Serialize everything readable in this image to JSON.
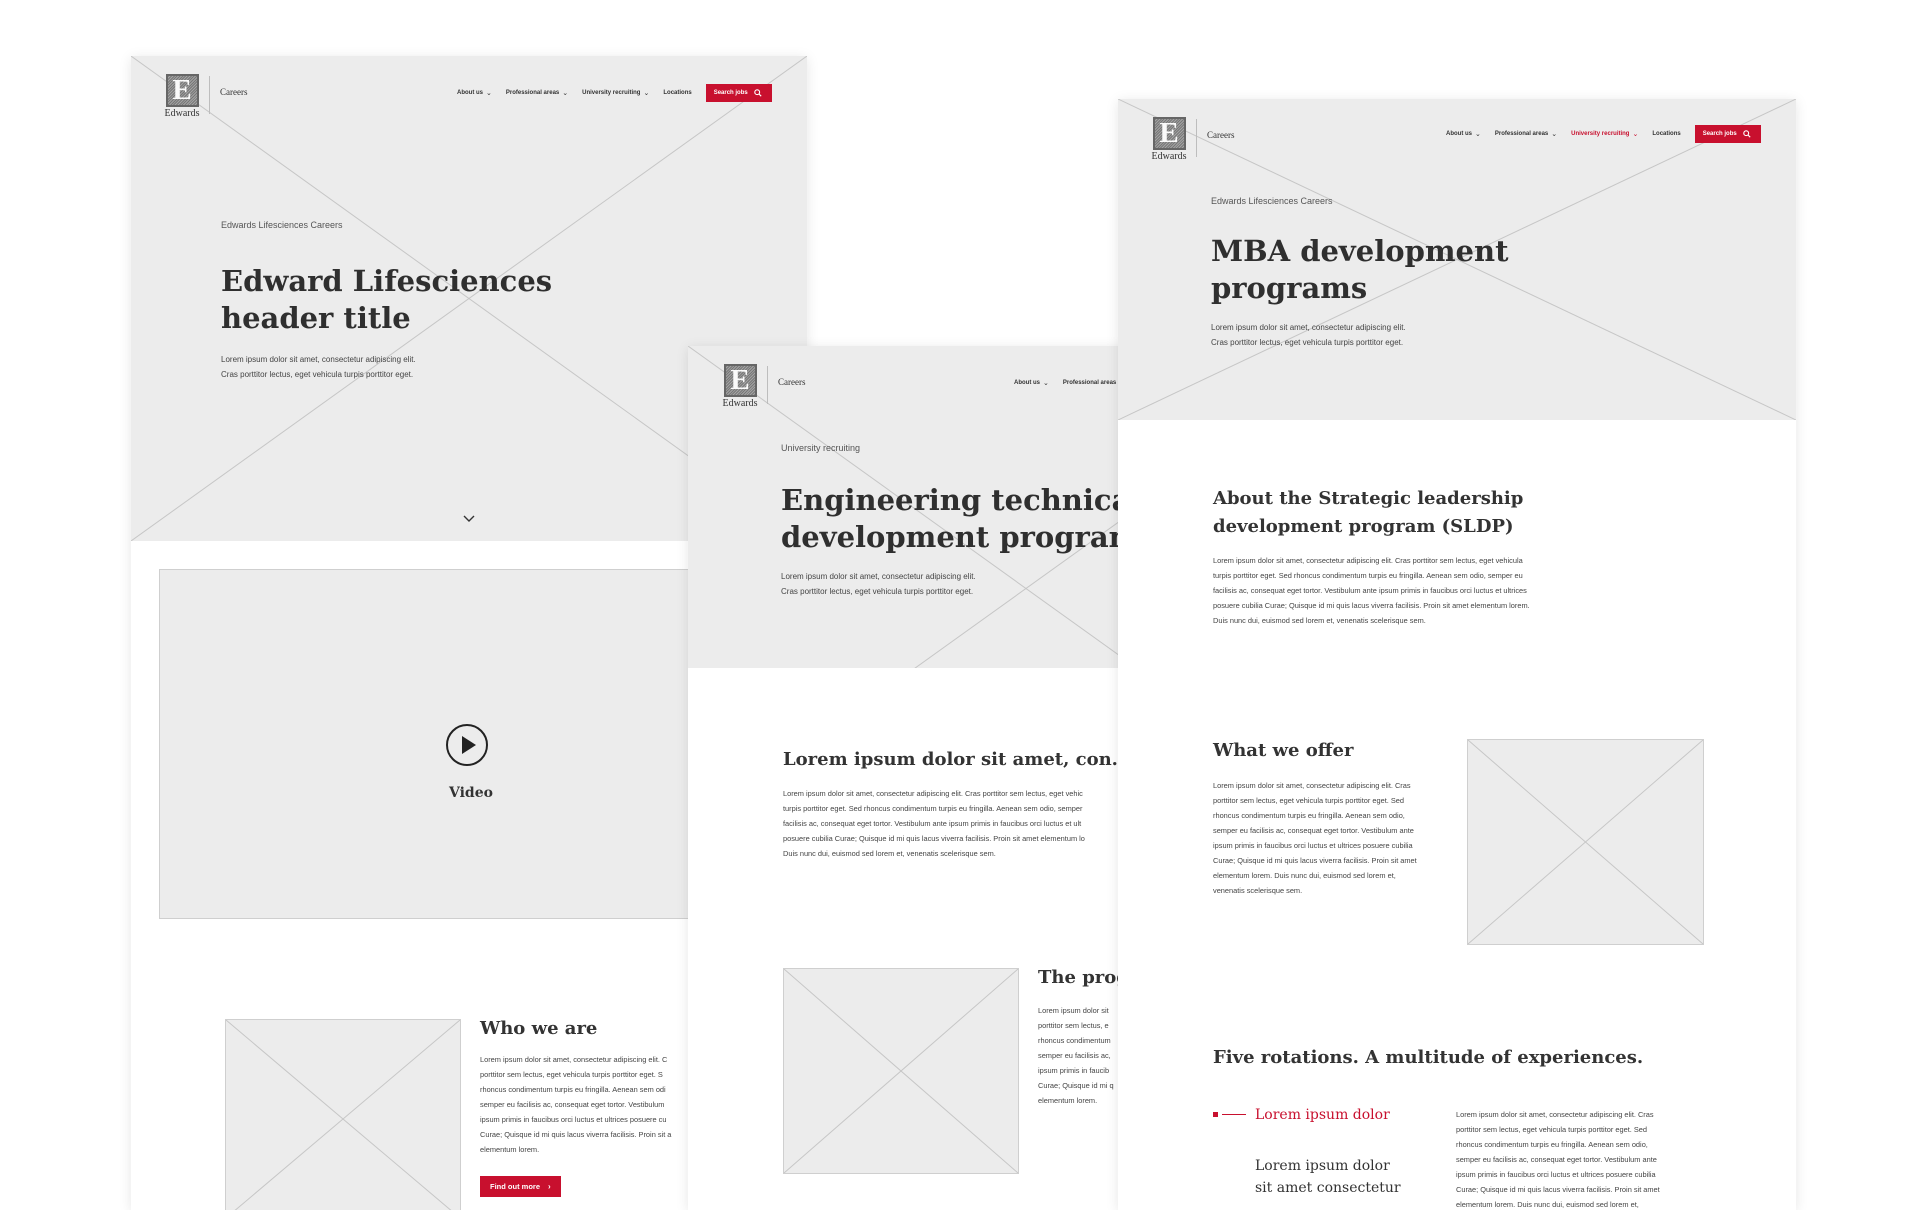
{
  "colors": {
    "brand_red": "#c8102e",
    "placeholder_gray": "#ececec",
    "text_dark": "#333333"
  },
  "logo": {
    "letter": "E",
    "word": "Edwards",
    "careers": "Careers"
  },
  "nav": {
    "about": "About us",
    "professional": "Professional areas",
    "university": "University recruiting",
    "locations": "Locations",
    "search": "Search jobs",
    "search_icon": "search-icon",
    "chevron_icon": "chevron-down-icon"
  },
  "page_a": {
    "eyebrow": "Edwards Lifesciences Careers",
    "title_lines": [
      "Edward Lifesciences",
      "header title"
    ],
    "lead_lines": [
      "Lorem ipsum dolor sit amet, consectetur adipiscing elit.",
      "Cras porttitor lectus, eget vehicula turpis porttitor eget."
    ],
    "video_label": "Video",
    "who_title": "Who we are",
    "who_lines": [
      "Lorem ipsum dolor sit amet, consectetur adipiscing elit. C",
      "porttitor sem lectus, eget vehicula turpis porttitor eget. S",
      "rhoncus condimentum turpis eu fringilla. Aenean sem odi",
      "semper eu facilisis ac, consequat eget tortor. Vestibulum",
      "ipsum primis in faucibus orci luctus et ultrices posuere cu",
      "Curae; Quisque id mi quis lacus viverra facilisis. Proin sit a",
      "elementum lorem."
    ],
    "cta": "Find out more"
  },
  "page_b": {
    "eyebrow": "University recruiting",
    "title_lines": [
      "Engineering technical",
      "development program"
    ],
    "lead_lines": [
      "Lorem ipsum dolor sit amet, consectetur adipiscing elit.",
      "Cras porttitor lectus, eget vehicula turpis porttitor eget."
    ],
    "section_title": "Lorem ipsum dolor sit amet, con.",
    "section_lines": [
      "Lorem ipsum dolor sit amet, consectetur adipiscing elit. Cras porttitor sem lectus, eget vehic",
      "turpis porttitor eget. Sed rhoncus condimentum turpis eu fringilla. Aenean sem odio, semper",
      "facilisis ac, consequat eget tortor. Vestibulum ante ipsum primis in faucibus orci luctus et ult",
      "posuere cubilia Curae; Quisque id mi quis lacus viverra facilisis. Proin sit amet elementum lo",
      "Duis nunc dui, euismod sed lorem et, venenatis scelerisque sem."
    ],
    "prog_title": "The prog",
    "prog_lines": [
      "Lorem ipsum dolor sit",
      "porttitor sem lectus, e",
      "rhoncus condimentum",
      "semper eu facilisis ac,",
      "ipsum primis in faucib",
      "Curae; Quisque id mi q",
      "elementum lorem."
    ]
  },
  "page_c": {
    "eyebrow": "Edwards Lifesciences Careers",
    "title_lines": [
      "MBA development",
      "programs"
    ],
    "lead_lines": [
      "Lorem ipsum dolor sit amet, consectetur adipiscing elit.",
      "Cras porttitor lectus, eget vehicula turpis porttitor eget."
    ],
    "about_title_lines": [
      "About the Strategic leadership",
      "development program (SLDP)"
    ],
    "about_lines": [
      "Lorem ipsum dolor sit amet, consectetur adipiscing elit. Cras porttitor sem lectus, eget vehicula",
      "turpis porttitor eget. Sed rhoncus condimentum turpis eu fringilla. Aenean sem odio, semper eu",
      "facilisis ac, consequat eget tortor. Vestibulum ante ipsum primis in faucibus orci luctus et ultrices",
      "posuere cubilia Curae; Quisque id mi quis lacus viverra facilisis. Proin sit amet elementum lorem.",
      "Duis nunc dui, euismod sed lorem et, venenatis scelerisque sem."
    ],
    "offer_title": "What we offer",
    "offer_lines": [
      "Lorem ipsum dolor sit amet, consectetur adipiscing elit. Cras",
      "porttitor sem lectus, eget vehicula turpis porttitor eget. Sed",
      "rhoncus condimentum turpis eu fringilla. Aenean sem odio,",
      "semper eu facilisis ac, consequat eget tortor. Vestibulum ante",
      "ipsum primis in faucibus orci luctus et ultrices posuere cubilia",
      "Curae; Quisque id mi quis lacus viverra facilisis. Proin sit amet",
      "elementum lorem. Duis nunc dui, euismod sed lorem et,",
      "venenatis scelerisque sem."
    ],
    "rotations_title": "Five rotations. A multitude of experiences.",
    "rotation_1": "Lorem ipsum dolor",
    "rotation_2_lines": [
      "Lorem ipsum dolor",
      "sit amet consectetur"
    ],
    "rotation_body_lines": [
      "Lorem ipsum dolor sit amet, consectetur adipiscing elit. Cras",
      "porttitor sem lectus, eget vehicula turpis porttitor eget. Sed",
      "rhoncus condimentum turpis eu fringilla. Aenean sem odio,",
      "semper eu facilisis ac, consequat eget tortor. Vestibulum ante",
      "ipsum primis in faucibus orci luctus et ultrices posuere cubilia",
      "Curae; Quisque id mi quis lacus viverra facilisis. Proin sit amet",
      "elementum lorem. Duis nunc dui, euismod sed lorem et,"
    ]
  }
}
